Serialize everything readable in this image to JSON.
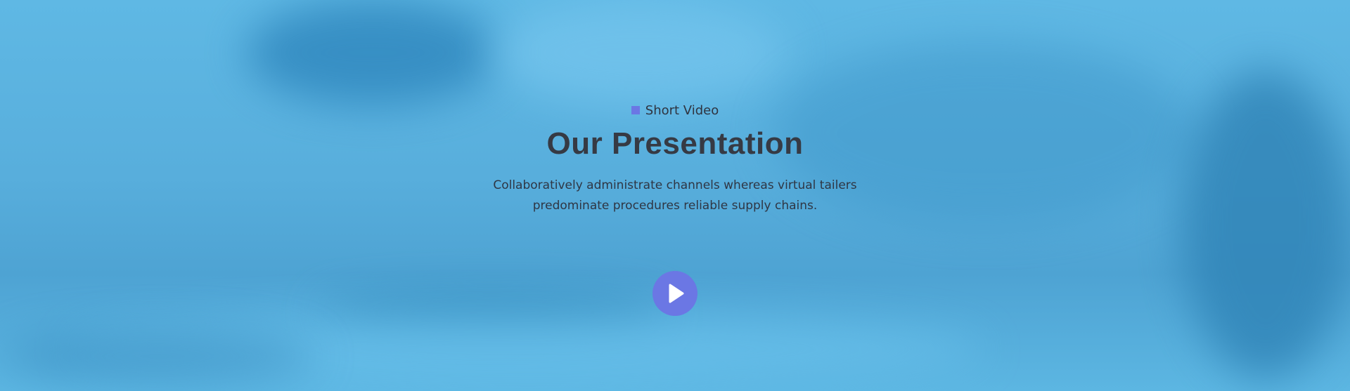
{
  "section": {
    "eyebrow": "Short Video",
    "title": "Our Presentation",
    "description_line1": "Collaboratively administrate channels whereas virtual tailers",
    "description_line2": "predominate procedures reliable supply chains.",
    "play_icon": "play-icon"
  },
  "colors": {
    "accent": "#6b77e4",
    "overlay": "#5ab4e0",
    "text": "#363a44"
  }
}
